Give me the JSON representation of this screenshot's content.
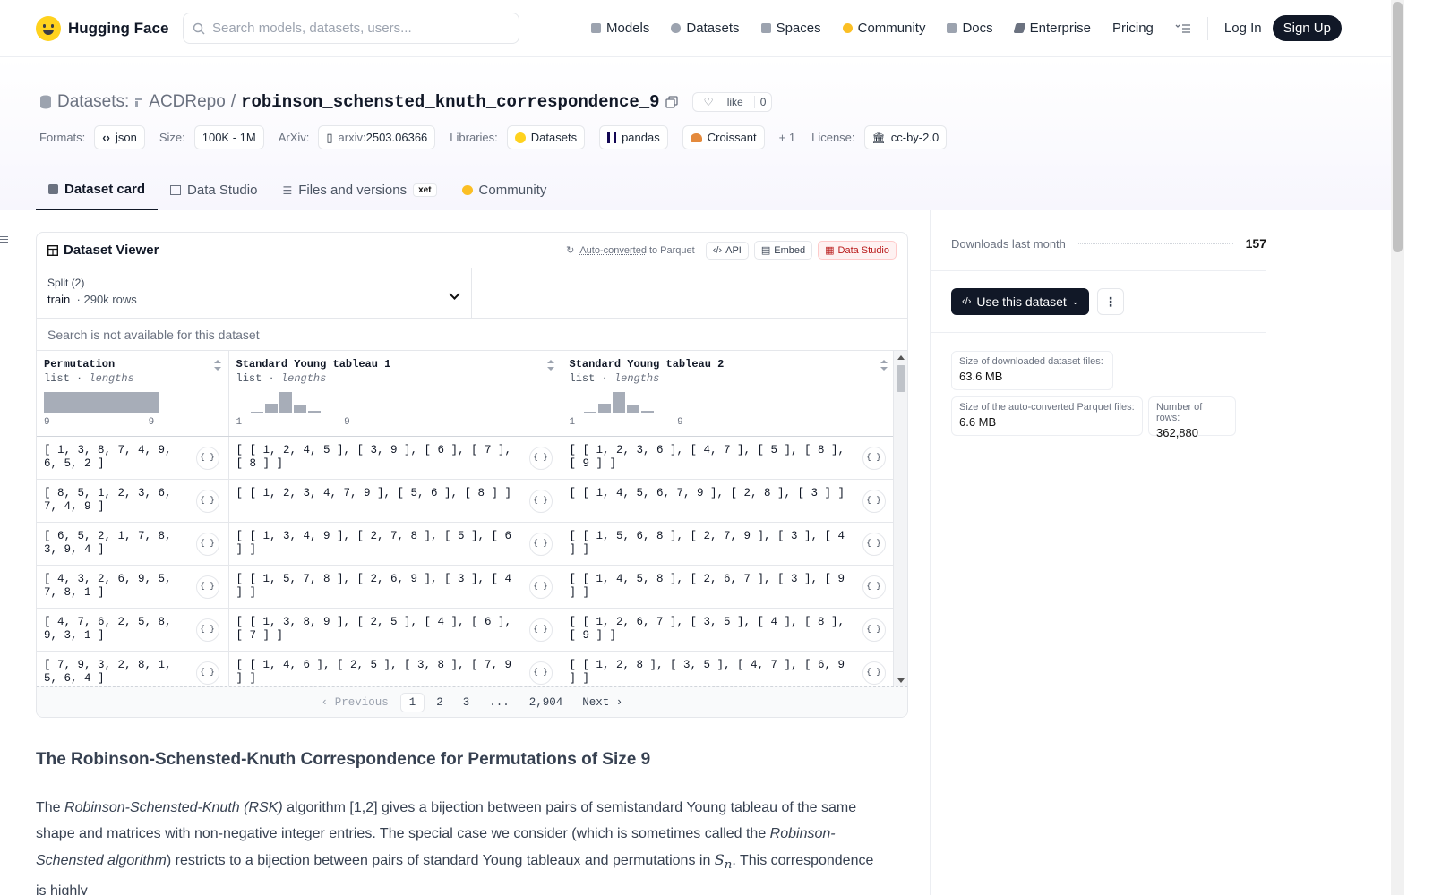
{
  "nav": {
    "brand": "Hugging Face",
    "search_placeholder": "Search models, datasets, users...",
    "links": [
      {
        "label": "Models",
        "icon": "cube-icon",
        "color": "#9ca3af"
      },
      {
        "label": "Datasets",
        "icon": "database-icon",
        "color": "#9ca3af"
      },
      {
        "label": "Spaces",
        "icon": "grid-icon",
        "color": "#9ca3af"
      },
      {
        "label": "Community",
        "icon": "community-icon",
        "color": "#fbbf24"
      },
      {
        "label": "Docs",
        "icon": "book-icon",
        "color": "#9ca3af"
      },
      {
        "label": "Enterprise",
        "icon": "enterprise-icon",
        "color": "#6b7280"
      },
      {
        "label": "Pricing"
      }
    ],
    "login": "Log In",
    "signup": "Sign Up"
  },
  "header": {
    "section": "Datasets:",
    "owner": "ACDRepo",
    "repo": "robinson_schensted_knuth_correspondence_9",
    "like_label": "like",
    "like_count": "0",
    "formats_label": "Formats:",
    "format": "json",
    "size_label": "Size:",
    "size": "100K - 1M",
    "arxiv_label": "ArXiv:",
    "arxiv_prefix": "arxiv:",
    "arxiv_id": "2503.06366",
    "libraries_label": "Libraries:",
    "libraries": [
      "Datasets",
      "pandas",
      "Croissant"
    ],
    "libraries_more": "+ 1",
    "license_label": "License:",
    "license": "cc-by-2.0"
  },
  "tabs": [
    {
      "label": "Dataset card",
      "active": true
    },
    {
      "label": "Data Studio"
    },
    {
      "label": "Files and versions",
      "badge": "xet"
    },
    {
      "label": "Community"
    }
  ],
  "viewer": {
    "title": "Dataset Viewer",
    "auto_converted": "Auto-converted",
    "to_parquet": "to Parquet",
    "api": "API",
    "embed": "Embed",
    "data_studio": "Data Studio",
    "split_label": "Split (2)",
    "split_name": "train",
    "split_rows": "290k rows",
    "search_placeholder": "Search is not available for this dataset",
    "columns": [
      {
        "name": "Permutation",
        "type": "list",
        "stat": "lengths",
        "min": "9",
        "max": "9",
        "hist": [
          1.0
        ]
      },
      {
        "name": "Standard Young tableau 1",
        "type": "list",
        "stat": "lengths",
        "min": "1",
        "max": "9",
        "hist": [
          0.05,
          0.1,
          0.45,
          1.0,
          0.4,
          0.12,
          0.05,
          0.04
        ]
      },
      {
        "name": "Standard Young tableau 2",
        "type": "list",
        "stat": "lengths",
        "min": "1",
        "max": "9",
        "hist": [
          0.05,
          0.1,
          0.45,
          1.0,
          0.4,
          0.12,
          0.05,
          0.04
        ]
      }
    ],
    "rows": [
      [
        "[ 1, 3, 8, 7, 4, 9, 6, 5, 2 ]",
        "[ [ 1, 2, 4, 5 ], [ 3, 9 ], [ 6 ], [ 7 ], [ 8 ] ]",
        "[ [ 1, 2, 3, 6 ], [ 4, 7 ], [ 5 ], [ 8 ], [ 9 ] ]"
      ],
      [
        "[ 8, 5, 1, 2, 3, 6, 7, 4, 9 ]",
        "[ [ 1, 2, 3, 4, 7, 9 ], [ 5, 6 ], [ 8 ] ]",
        "[ [ 1, 4, 5, 6, 7, 9 ], [ 2, 8 ], [ 3 ] ]"
      ],
      [
        "[ 6, 5, 2, 1, 7, 8, 3, 9, 4 ]",
        "[ [ 1, 3, 4, 9 ], [ 2, 7, 8 ], [ 5 ], [ 6 ] ]",
        "[ [ 1, 5, 6, 8 ], [ 2, 7, 9 ], [ 3 ], [ 4 ] ]"
      ],
      [
        "[ 4, 3, 2, 6, 9, 5, 7, 8, 1 ]",
        "[ [ 1, 5, 7, 8 ], [ 2, 6, 9 ], [ 3 ], [ 4 ] ]",
        "[ [ 1, 4, 5, 8 ], [ 2, 6, 7 ], [ 3 ], [ 9 ] ]"
      ],
      [
        "[ 4, 7, 6, 2, 5, 8, 9, 3, 1 ]",
        "[ [ 1, 3, 8, 9 ], [ 2, 5 ], [ 4 ], [ 6 ], [ 7 ] ]",
        "[ [ 1, 2, 6, 7 ], [ 3, 5 ], [ 4 ], [ 8 ], [ 9 ] ]"
      ],
      [
        "[ 7, 9, 3, 2, 8, 1, 5, 6, 4 ]",
        "[ [ 1, 4, 6 ], [ 2, 5 ], [ 3, 8 ], [ 7, 9 ] ]",
        "[ [ 1, 2, 8 ], [ 3, 5 ], [ 4, 7 ], [ 6, 9 ] ]"
      ]
    ],
    "pager": {
      "previous": "Previous",
      "pages": [
        "1",
        "2",
        "3",
        "...",
        "2,904"
      ],
      "current": "1",
      "next": "Next"
    }
  },
  "sidebar": {
    "downloads_label": "Downloads last month",
    "downloads_value": "157",
    "use_button": "Use this dataset",
    "stats": [
      {
        "label": "Size of downloaded dataset files:",
        "value": "63.6 MB"
      },
      {
        "label": "Size of the auto-converted Parquet files:",
        "value": "6.6 MB"
      },
      {
        "label": "Number of rows:",
        "value": "362,880"
      }
    ]
  },
  "article": {
    "heading": "The Robinson-Schensted-Knuth Correspondence for Permutations of Size 9",
    "p_the": "The ",
    "p_rsk": "Robinson-Schensted-Knuth (RSK)",
    "p_1": " algorithm [1,2] gives a bijection between pairs of semistandard Young tableau of the same shape and matrices with non-negative integer entries. The special case we consider (which is sometimes called the ",
    "p_rs": "Robinson-Schensted algorithm",
    "p_2": ") restricts to a bijection between pairs of standard Young tableaux and permutations in ",
    "p_sn": "S",
    "p_sn_sub": "n",
    "p_3": ". This correspondence is highly"
  },
  "colors": {
    "accent": "#111827",
    "hf_yellow": "#ffd21e",
    "studio_red": "#b91c1c"
  }
}
